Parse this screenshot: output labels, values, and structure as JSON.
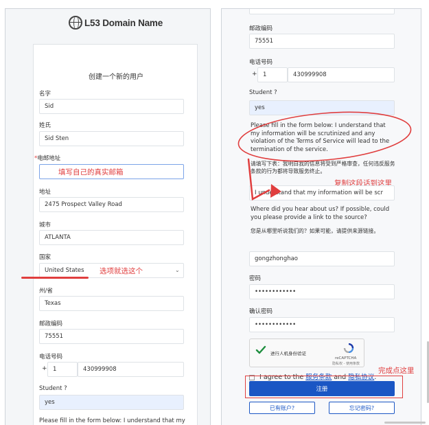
{
  "brand": {
    "logo_text": "L53 Domain Name"
  },
  "left": {
    "card_title": "创建一个新的用户",
    "first_name": {
      "label": "名字",
      "value": "Sid"
    },
    "last_name": {
      "label": "姓氏",
      "value": "Sid Sten"
    },
    "email": {
      "required_mark": "*",
      "label": "电邮地址",
      "annotation": "填写自己的真实邮箱"
    },
    "address": {
      "label": "地址",
      "value": "2475 Prospect Valley Road"
    },
    "city": {
      "label": "城市",
      "value": "ATLANTA"
    },
    "country": {
      "label": "国家",
      "value": "United States",
      "annotation": "选项就选这个"
    },
    "state": {
      "label": "州/省",
      "value": "Texas"
    },
    "zip": {
      "label": "邮政编码",
      "value": "75551"
    },
    "phone": {
      "label": "电话号码",
      "prefix": "+",
      "code": "1",
      "number": "430999908"
    },
    "student": {
      "label": "Student ?",
      "value": "yes"
    },
    "note_partial": "Please fill in the form below: I understand that my information will be scrutinized and any"
  },
  "right": {
    "top_partial": "Texas",
    "zip": {
      "label": "邮政编码",
      "value": "75551"
    },
    "phone": {
      "label": "电话号码",
      "prefix": "+",
      "code": "1",
      "number": "430999908"
    },
    "student": {
      "label": "Student ?",
      "value": "yes"
    },
    "note_en": "Please fill in the form below: I understand that my information will be scrutinized and any violation of the Terms of Service will lead to the termination of the service.",
    "note_cn": "请填写下表：我明白我的信息将受到严格审查，任何违反服务条款的行为都将导致服务终止。",
    "copy_annotation": "复制这段话到这里",
    "statement_input": "I understand that my information will be scr",
    "source_q_en": "Where did you hear about us? If possible, could you please provide a link to the source?",
    "source_q_cn": "您是从哪里听说我们的？如果可能，请提供来源链接。",
    "source_value": "gongzhonghao",
    "password": {
      "label": "密码",
      "value": "••••••••••••"
    },
    "confirm": {
      "label": "确认密码",
      "value": "••••••••••••"
    },
    "captcha": {
      "label": "进行人机身份验证",
      "name": "reCAPTCHA",
      "links": "隐私权 - 使用条款"
    },
    "agree": {
      "prefix": "I agree to the",
      "tos": "服务条款",
      "and": "and",
      "privacy": "隐私协议",
      "suffix": "."
    },
    "finish_annotation": "完成点这里",
    "register_button": "注册",
    "have_account_button": "已有账户?",
    "forgot_button": "忘记密码?"
  },
  "colors": {
    "accent": "#1a56c4",
    "annotation": "#e03e3e",
    "field_blue": "#e8f0fe"
  },
  "icons": [
    "globe-logo-icon",
    "chevron-down-icon",
    "checkmark-icon",
    "recaptcha-icon"
  ]
}
